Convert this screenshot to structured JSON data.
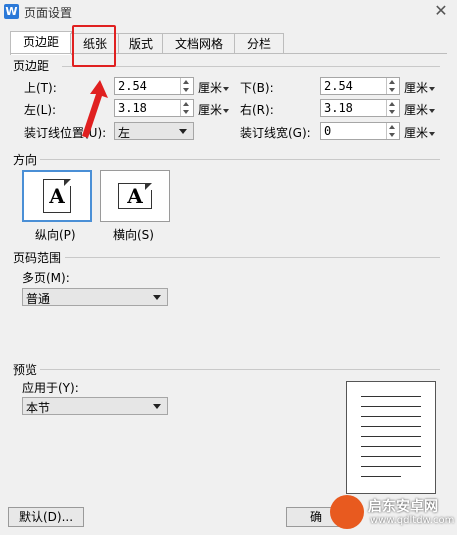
{
  "window": {
    "title": "页面设置",
    "app_icon": "W"
  },
  "tabs": [
    {
      "label": "页边距",
      "active": true
    },
    {
      "label": "纸张",
      "active": false
    },
    {
      "label": "版式",
      "active": false
    },
    {
      "label": "文档网格",
      "active": false
    },
    {
      "label": "分栏",
      "active": false
    }
  ],
  "margins": {
    "section": "页边距",
    "top_label": "上(T):",
    "top_value": "2.54",
    "top_unit": "厘米",
    "bottom_label": "下(B):",
    "bottom_value": "2.54",
    "bottom_unit": "厘米",
    "left_label": "左(L):",
    "left_value": "3.18",
    "left_unit": "厘米",
    "right_label": "右(R):",
    "right_value": "3.18",
    "right_unit": "厘米",
    "gutter_pos_label": "装订线位置(U):",
    "gutter_pos_value": "左",
    "gutter_width_label": "装订线宽(G):",
    "gutter_width_value": "0",
    "gutter_width_unit": "厘米"
  },
  "orientation": {
    "section": "方向",
    "portrait_label": "纵向(P)",
    "landscape_label": "横向(S)",
    "glyph": "A",
    "selected": "portrait"
  },
  "pages": {
    "section": "页码范围",
    "multi_label": "多页(M):",
    "multi_value": "普通"
  },
  "preview": {
    "section": "预览",
    "apply_label": "应用于(Y):",
    "apply_value": "本节"
  },
  "buttons": {
    "default": "默认(D)...",
    "ok": "确"
  },
  "watermark": {
    "text": "启东安卓网",
    "sub": "www.qdltdw.com"
  },
  "colors": {
    "accent": "#4a8fd6",
    "annotation": "#e02020",
    "app_icon": "#2b79d8"
  }
}
